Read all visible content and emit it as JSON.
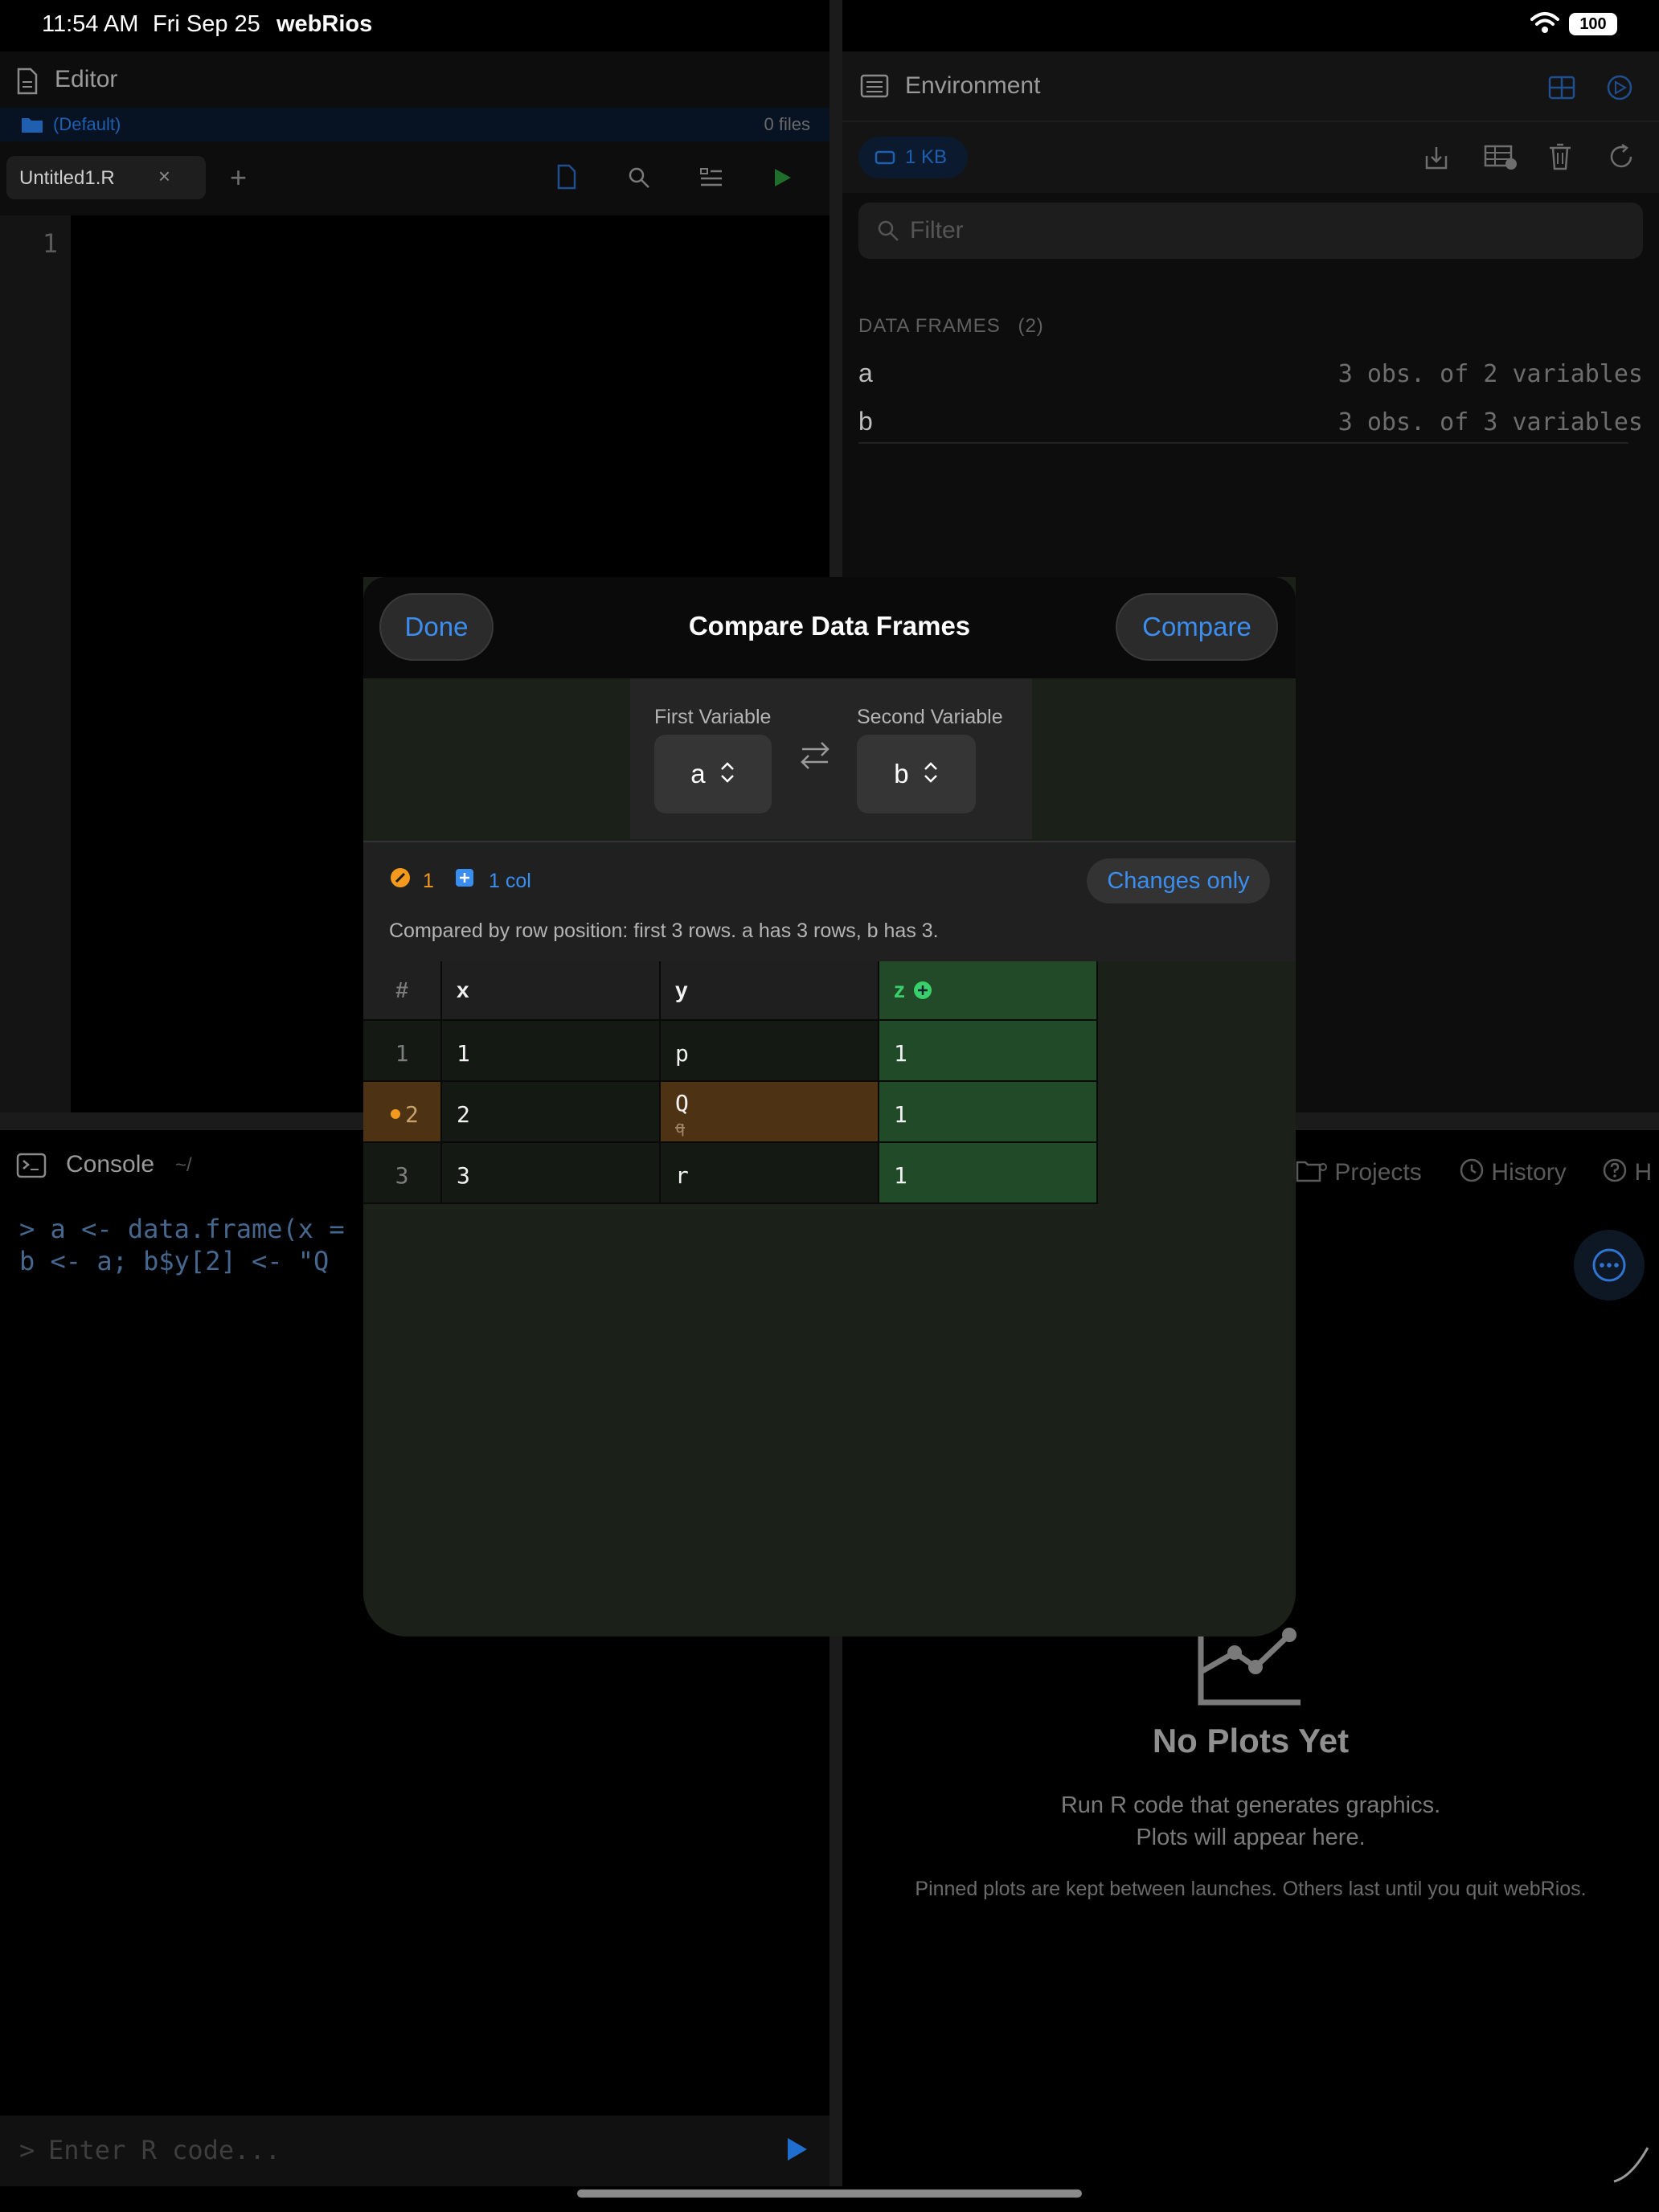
{
  "status": {
    "time": "11:54 AM",
    "date": "Fri Sep 25",
    "app": "webRios",
    "battery": "100"
  },
  "editor": {
    "title": "Editor",
    "folder": "(Default)",
    "file_count": "0 files",
    "tab_name": "Untitled1.R",
    "tab_close": "×",
    "tab_add": "+",
    "line_number": "1"
  },
  "environment": {
    "title": "Environment",
    "memory": "1 KB",
    "filter_placeholder": "Filter",
    "section": "DATA FRAMES",
    "section_count": "(2)",
    "frames": [
      {
        "name": "a",
        "desc": "3 obs. of 2 variables"
      },
      {
        "name": "b",
        "desc": "3 obs. of 3 variables"
      }
    ]
  },
  "console": {
    "title": "Console",
    "path": "~/",
    "lines": [
      "> a <- data.frame(x =",
      "  b <- a; b$y[2] <- \"Q"
    ],
    "prompt": ">",
    "placeholder": "Enter R code..."
  },
  "right_tabs": {
    "projects": "Projects",
    "history": "History",
    "help": "H"
  },
  "plots": {
    "title": "No Plots Yet",
    "line1": "Run R code that generates graphics.",
    "line2": "Plots will appear here.",
    "pinned_note": "Pinned plots are kept between launches. Others last until you quit webRios."
  },
  "modal": {
    "title": "Compare Data Frames",
    "done": "Done",
    "compare": "Compare",
    "first_label": "First Variable",
    "second_label": "Second Variable",
    "first_value": "a",
    "second_value": "b",
    "changed_count": "1",
    "added_cols": "1 col",
    "changes_only": "Changes only",
    "note": "Compared by row position: first 3 rows. a has 3 rows, b has 3.",
    "table": {
      "headers": [
        "#",
        "x",
        "y",
        "z"
      ],
      "rows": [
        {
          "idx": "1",
          "x": "1",
          "y": "p",
          "z": "1"
        },
        {
          "idx": "2",
          "x": "2",
          "y": "Q",
          "y_old": "q",
          "z": "1"
        },
        {
          "idx": "3",
          "x": "3",
          "y": "r",
          "z": "1"
        }
      ]
    }
  },
  "colors": {
    "accent": "#3b8ef0",
    "changed": "#f39a1e",
    "added": "#39d06a",
    "added_bg": "#204a28",
    "changed_bg": "#4d3313"
  }
}
